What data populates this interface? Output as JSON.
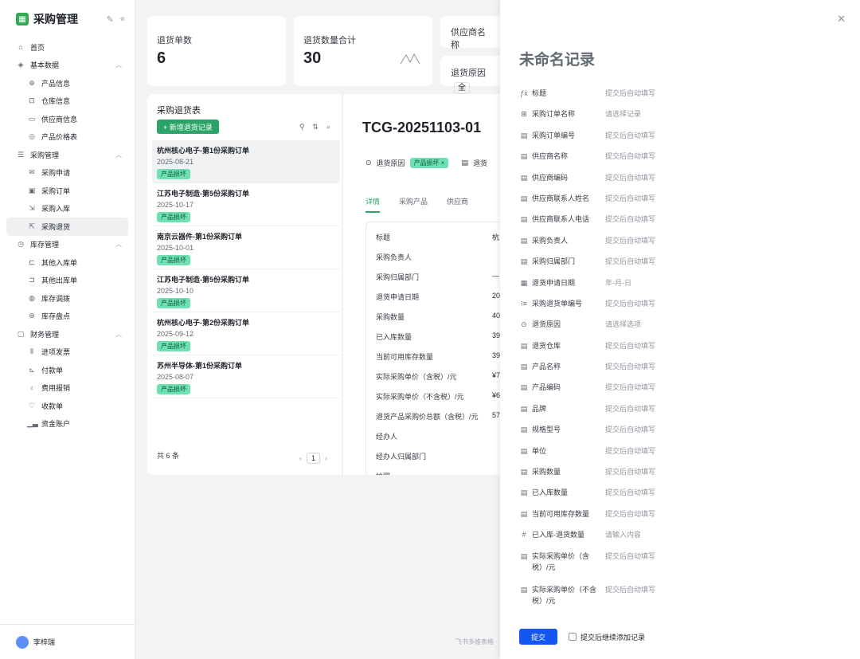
{
  "sidebar": {
    "app_title": "采购管理",
    "home": "首页",
    "groups": [
      {
        "label": "基本数据",
        "icon": "layers-icon",
        "items": [
          "产品信息",
          "仓库信息",
          "供应商信息",
          "产品价格表"
        ]
      },
      {
        "label": "采购管理",
        "icon": "purchase-icon",
        "items": [
          "采购申请",
          "采购订单",
          "采购入库",
          "采购退货"
        ]
      },
      {
        "label": "库存管理",
        "icon": "inventory-icon",
        "items": [
          "其他入库单",
          "其他出库单",
          "库存调拨",
          "库存盘点"
        ]
      },
      {
        "label": "财务管理",
        "icon": "finance-icon",
        "items": [
          "进项发票",
          "付款单",
          "费用报销",
          "收款单",
          "资金账户"
        ]
      }
    ],
    "user": "李梓瑞"
  },
  "stats": {
    "return_count_label": "退货单数",
    "return_count": "6",
    "return_qty_label": "退货数量合计",
    "return_qty": "30",
    "supplier_label": "供应商名称",
    "reason_label": "退货原因",
    "reason_value": "全"
  },
  "list": {
    "title": "采购退货表",
    "add_label": "+ 新增退货记录",
    "rows": [
      {
        "title": "杭州核心电子-第1份采购订单",
        "date": "2025-08-21",
        "tag": "产品损坏"
      },
      {
        "title": "江苏电子制造-第5份采购订单",
        "date": "2025-10-17",
        "tag": "产品损坏"
      },
      {
        "title": "南京云器件-第1份采购订单",
        "date": "2025-10-01",
        "tag": "产品损坏"
      },
      {
        "title": "江苏电子制造-第5份采购订单",
        "date": "2025-10-10",
        "tag": "产品损坏"
      },
      {
        "title": "杭州核心电子-第2份采购订单",
        "date": "2025-09-12",
        "tag": "产品损坏"
      },
      {
        "title": "苏州半导体-第1份采购订单",
        "date": "2025-08-07",
        "tag": "产品损坏"
      }
    ],
    "total": "共 6 条",
    "page": "1"
  },
  "detail": {
    "id": "TCG-20251103-01",
    "reason_label": "退货原因",
    "reason_tag": "产品损坏 ×",
    "extra_label": "退货",
    "tabs": [
      "详情",
      "采购产品",
      "供应商"
    ],
    "fields": [
      "标题",
      "采购负责人",
      "采购归属部门",
      "退货申请日期",
      "采购数量",
      "已入库数量",
      "当前可用库存数量",
      "实际采购单价（含税）/元",
      "实际采购单价（不含税）/元",
      "退货产品采购价总额（含税）/元",
      "经办人",
      "经办人归属部门",
      "拍照"
    ],
    "values": [
      "杭",
      "",
      "—",
      "20",
      "40",
      "39",
      "39",
      "¥7",
      "¥6",
      "57",
      "",
      "",
      ""
    ]
  },
  "watermark": "飞书多维表格",
  "modal": {
    "title": "未命名记录",
    "fields": [
      {
        "icon": "formula-icon",
        "label": "标题",
        "hint": "提交后自动填写"
      },
      {
        "icon": "link-icon",
        "label": "采购订单名称",
        "hint": "请选择记录"
      },
      {
        "icon": "lookup-icon",
        "label": "采购订单编号",
        "hint": "提交后自动填写"
      },
      {
        "icon": "lookup-icon",
        "label": "供应商名称",
        "hint": "提交后自动填写"
      },
      {
        "icon": "lookup-icon",
        "label": "供应商编码",
        "hint": "提交后自动填写"
      },
      {
        "icon": "lookup-icon",
        "label": "供应商联系人姓名",
        "hint": "提交后自动填写"
      },
      {
        "icon": "lookup-icon",
        "label": "供应商联系人电话",
        "hint": "提交后自动填写"
      },
      {
        "icon": "lookup-icon",
        "label": "采购负责人",
        "hint": "提交后自动填写"
      },
      {
        "icon": "lookup-icon",
        "label": "采购归属部门",
        "hint": "提交后自动填写"
      },
      {
        "icon": "calendar-icon",
        "label": "退货申请日期",
        "hint": "年-月-日"
      },
      {
        "icon": "autonumber-icon",
        "label": "采购退货单编号",
        "hint": "提交后自动填写"
      },
      {
        "icon": "single-select-icon",
        "label": "退货原因",
        "hint": "请选择选项"
      },
      {
        "icon": "lookup-icon",
        "label": "退货仓库",
        "hint": "提交后自动填写"
      },
      {
        "icon": "lookup-icon",
        "label": "产品名称",
        "hint": "提交后自动填写"
      },
      {
        "icon": "lookup-icon",
        "label": "产品编码",
        "hint": "提交后自动填写"
      },
      {
        "icon": "lookup-icon",
        "label": "品牌",
        "hint": "提交后自动填写"
      },
      {
        "icon": "lookup-icon",
        "label": "规格型号",
        "hint": "提交后自动填写"
      },
      {
        "icon": "lookup-icon",
        "label": "单位",
        "hint": "提交后自动填写"
      },
      {
        "icon": "lookup-icon",
        "label": "采购数量",
        "hint": "提交后自动填写"
      },
      {
        "icon": "lookup-icon",
        "label": "已入库数量",
        "hint": "提交后自动填写"
      },
      {
        "icon": "lookup-icon",
        "label": "当前可用库存数量",
        "hint": "提交后自动填写"
      },
      {
        "icon": "number-icon",
        "label": "已入库-退货数量",
        "hint": "请输入内容"
      },
      {
        "icon": "lookup-icon",
        "label": "实际采购单价（含税）/元",
        "hint": "提交后自动填写"
      },
      {
        "icon": "lookup-icon",
        "label": "实际采购单价（不含税）/元",
        "hint": "提交后自动填写"
      }
    ],
    "submit": "提交",
    "continue_label": "提交后继续添加记录"
  }
}
